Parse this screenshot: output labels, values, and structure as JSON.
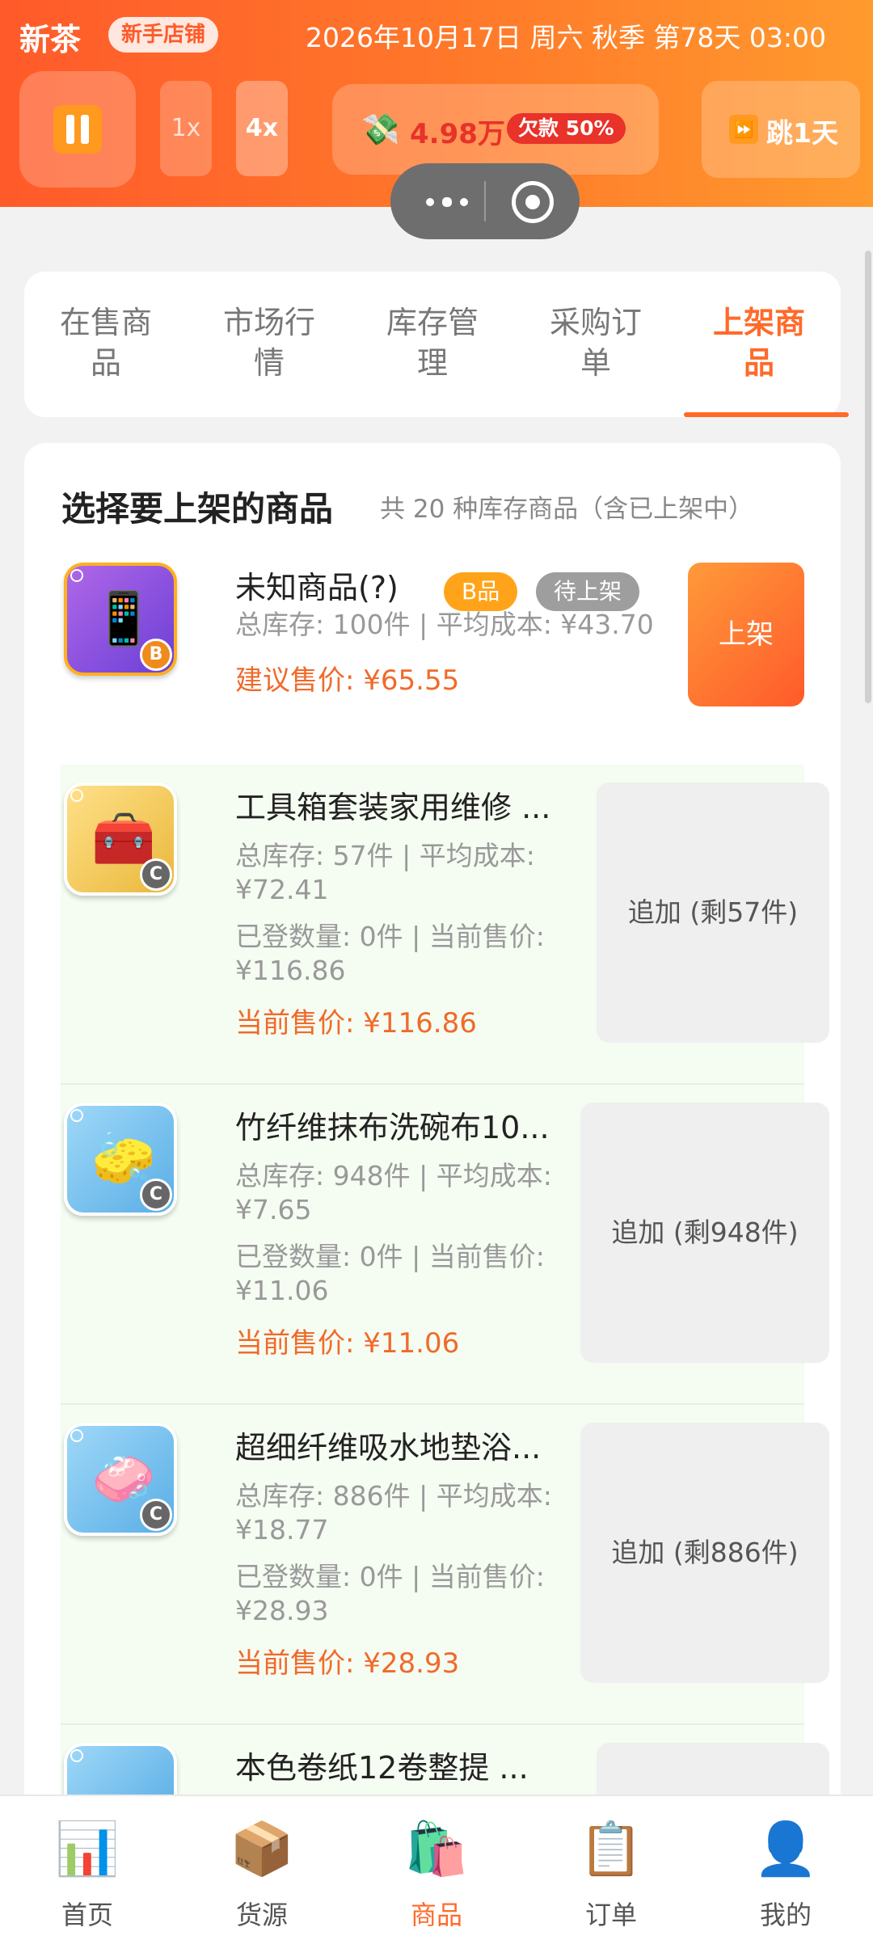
{
  "header": {
    "brand": "新茶",
    "shop_badge": "新手店铺",
    "datetime": "2026年10月17日 周六 秋季 第78天 03:00",
    "speed_1x": "1x",
    "speed_4x": "4x",
    "money_icon": "💸",
    "money_amount": "4.98万",
    "debt_label": "欠款 50%",
    "skip_icon": "⏩",
    "skip_label": "跳1天"
  },
  "tabs": [
    "在售商品",
    "市场行情",
    "库存管理",
    "采购订单",
    "上架商品"
  ],
  "active_tab": "上架商品",
  "panel": {
    "title": "选择要上架的商品",
    "subtitle": "共 20 种库存商品（含已上架中）"
  },
  "products": [
    {
      "name": "未知商品(?)",
      "grade": "B",
      "grade_badge": "B品",
      "status_badge": "待上架",
      "stock_cost": "总库存: 100件 | 平均成本: ¥43.70",
      "price": "建议售价: ¥65.55",
      "action": "上架",
      "art_icon": "📱"
    },
    {
      "name": "工具箱套装家用维修 ...",
      "grade": "C",
      "stock_cost": "总库存: 57件 | 平均成本: ¥72.41",
      "listed": "已登数量: 0件 | 当前售价: ¥116.86",
      "price": "当前售价: ¥116.86",
      "action": "追加 (剩57件)",
      "art_icon": "🧰"
    },
    {
      "name": "竹纤维抹布洗碗布10...",
      "grade": "C",
      "stock_cost": "总库存: 948件 | 平均成本: ¥7.65",
      "listed": "已登数量: 0件 | 当前售价: ¥11.06",
      "price": "当前售价: ¥11.06",
      "action": "追加 (剩948件)",
      "art_icon": "🧽"
    },
    {
      "name": "超细纤维吸水地垫浴...",
      "grade": "C",
      "stock_cost": "总库存: 886件 | 平均成本: ¥18.77",
      "listed": "已登数量: 0件 | 当前售价: ¥28.93",
      "price": "当前售价: ¥28.93",
      "action": "追加 (剩886件)",
      "art_icon": "🧼"
    },
    {
      "name": "本色卷纸12卷整提 ..."
    }
  ],
  "nav": [
    {
      "label": "首页",
      "icon": "📊"
    },
    {
      "label": "货源",
      "icon": "📦"
    },
    {
      "label": "商品",
      "icon": "🛍️"
    },
    {
      "label": "订单",
      "icon": "📋"
    },
    {
      "label": "我的",
      "icon": "👤"
    }
  ],
  "colors": {
    "accent": "#ff6a2a",
    "debt": "#e8322a",
    "row_bg": "#f5fcf2"
  }
}
